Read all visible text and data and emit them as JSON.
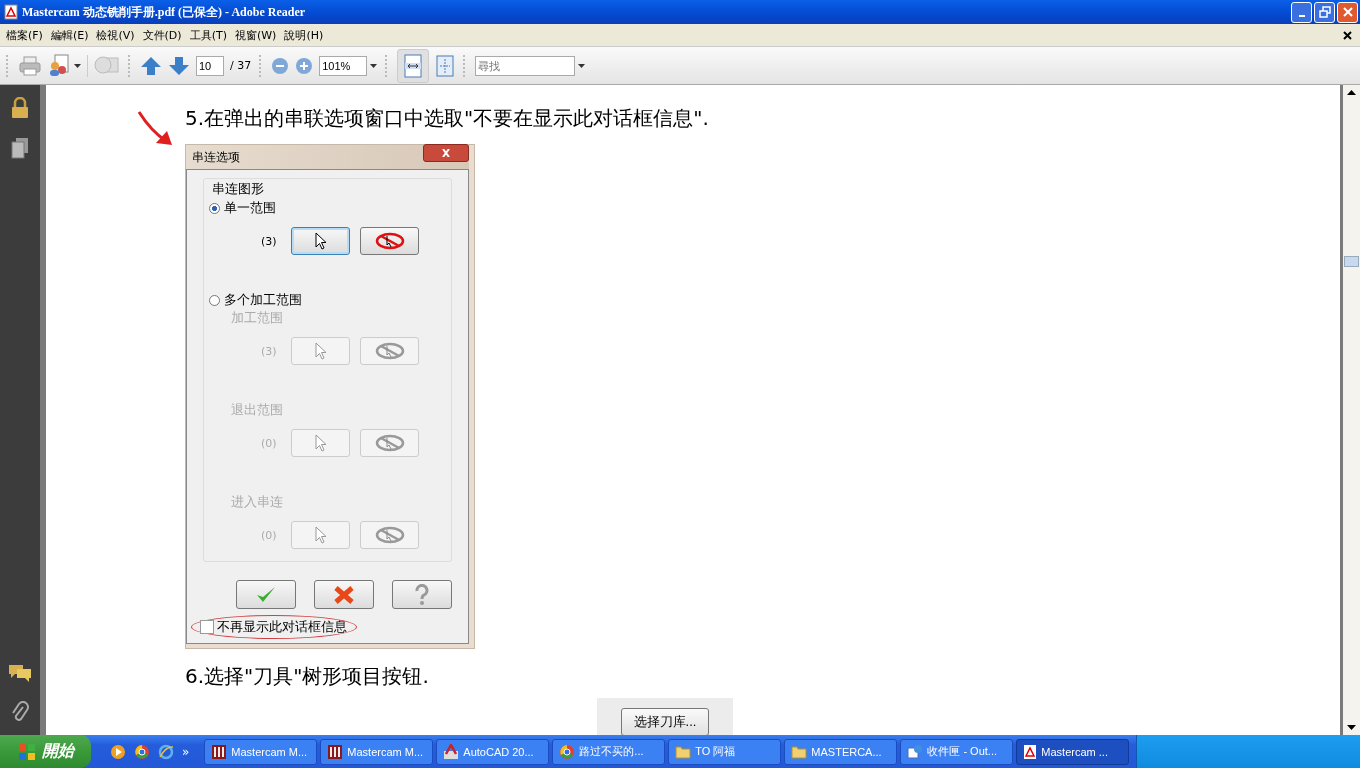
{
  "window": {
    "title": "Mastercam 动态铣削手册.pdf (已保全) - Adobe Reader"
  },
  "menu": [
    {
      "label": "檔案(F)"
    },
    {
      "label": "編輯(E)"
    },
    {
      "label": "檢視(V)"
    },
    {
      "label": "文件(D)"
    },
    {
      "label": "工具(T)"
    },
    {
      "label": "視窗(W)"
    },
    {
      "label": "說明(H)"
    }
  ],
  "toolbar": {
    "page_value": "10",
    "page_total": "/ 37",
    "zoom_value": "101%",
    "search_placeholder": "尋找",
    "fit_width_selected": true
  },
  "document": {
    "step_5": "5.在弹出的串联选项窗口中选取\"不要在显示此对话框信息\".",
    "dialog": {
      "title": "串连选项",
      "group_label": "串连图形",
      "options": [
        {
          "label": "单一范围",
          "selected": true,
          "rows": [
            {
              "count": "(3)",
              "disabled": false
            }
          ]
        },
        {
          "label": "多个加工范围",
          "selected": false,
          "rows": [
            {
              "label": "加工范围",
              "count": "(3)",
              "disabled": true
            },
            {
              "label": "退出范围",
              "count": "(0)",
              "disabled": true
            },
            {
              "label": "进入串连",
              "count": "(0)",
              "disabled": true
            }
          ]
        }
      ],
      "checkbox": {
        "label": "不再显示此对话框信息",
        "checked": false
      }
    },
    "step_6": "6.选择\"刀具\"树形项目按钮.",
    "embedded_button": "选择刀库..."
  },
  "taskbar": {
    "start": "開始",
    "quick_more": "»",
    "tasks": [
      {
        "label": "Mastercam M...",
        "kind": "mastercam",
        "selected": false
      },
      {
        "label": "Mastercam M...",
        "kind": "mastercam",
        "selected": false
      },
      {
        "label": "AutoCAD 20...",
        "kind": "autocad",
        "selected": false
      },
      {
        "label": "路过不买的...",
        "kind": "chrome",
        "selected": false
      },
      {
        "label": "TO 阿福",
        "kind": "folder",
        "selected": false
      },
      {
        "label": "MASTERCA...",
        "kind": "folder",
        "selected": false
      },
      {
        "label": "收件匣 - Out...",
        "kind": "outlook",
        "selected": false
      },
      {
        "label": "Mastercam ...",
        "kind": "pdf",
        "selected": true
      }
    ]
  }
}
